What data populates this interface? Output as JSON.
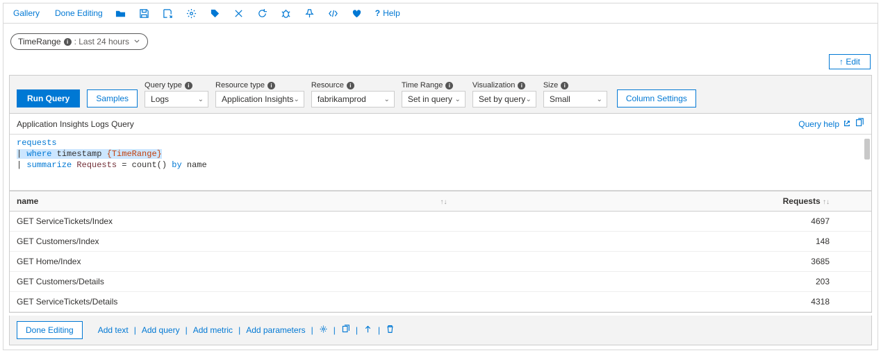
{
  "topbar": {
    "gallery": "Gallery",
    "done_editing": "Done Editing",
    "help": "Help"
  },
  "pill": {
    "label": "TimeRange",
    "suffix": ": Last 24 hours"
  },
  "edit_button": "↑ Edit",
  "query_toolbar": {
    "run": "Run Query",
    "samples": "Samples",
    "column_settings": "Column Settings",
    "fields": {
      "query_type": {
        "label": "Query type",
        "value": "Logs"
      },
      "resource_type": {
        "label": "Resource type",
        "value": "Application Insights"
      },
      "resource": {
        "label": "Resource",
        "value": "fabrikamprod"
      },
      "time_range": {
        "label": "Time Range",
        "value": "Set in query"
      },
      "visualization": {
        "label": "Visualization",
        "value": "Set by query"
      },
      "size": {
        "label": "Size",
        "value": "Small"
      }
    }
  },
  "query_title": "Application Insights Logs Query",
  "query_help": "Query help",
  "code": {
    "l1": "requests",
    "l2_kw": "where",
    "l2_field": "timestamp",
    "l2_param": "{TimeRange}",
    "l3_kw": "summarize",
    "l3_name": "Requests",
    "l3_op": "=",
    "l3_fn": "count()",
    "l3_by": "by",
    "l3_col": "name"
  },
  "table": {
    "col_name": "name",
    "col_requests": "Requests",
    "rows": [
      {
        "name": "GET ServiceTickets/Index",
        "requests": "4697"
      },
      {
        "name": "GET Customers/Index",
        "requests": "148"
      },
      {
        "name": "GET Home/Index",
        "requests": "3685"
      },
      {
        "name": "GET Customers/Details",
        "requests": "203"
      },
      {
        "name": "GET ServiceTickets/Details",
        "requests": "4318"
      }
    ]
  },
  "footer": {
    "done": "Done Editing",
    "add_text": "Add text",
    "add_query": "Add query",
    "add_metric": "Add metric",
    "add_params": "Add parameters"
  }
}
